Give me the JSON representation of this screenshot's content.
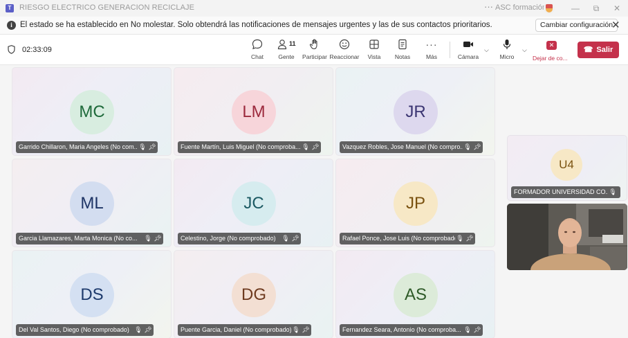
{
  "window": {
    "title": "RIESGO ELECTRICO GENERACION RECICLAJE",
    "more_glyph": "···",
    "org_name": "ASC formación",
    "minimize": "—",
    "restore": "⧉",
    "close": "✕"
  },
  "notification": {
    "text": "El estado se ha establecido en No molestar. Solo obtendrá las notificaciones de mensajes urgentes y las de sus contactos prioritarios.",
    "button": "Cambiar configuración",
    "close": "✕"
  },
  "toolbar": {
    "timer": "02:33:09",
    "chat": "Chat",
    "people": "Gente",
    "people_count": "11",
    "raise": "Participar",
    "react": "Reaccionar",
    "view": "Vista",
    "notes": "Notas",
    "more": "Más",
    "camera": "Cámara",
    "mic": "Micro",
    "leave_short": "Dejar de co...",
    "leave": "Salir"
  },
  "participants": [
    {
      "initials": "MC",
      "name": "Garrido Chillaron, Maria Angeles (No com...",
      "avatar_bg": "#d8ede0",
      "avatar_fg": "#1e6a3a"
    },
    {
      "initials": "LM",
      "name": "Fuente Martín, Luis Miguel (No comproba...",
      "avatar_bg": "#f7d5da",
      "avatar_fg": "#9c2a3d"
    },
    {
      "initials": "JR",
      "name": "Vazquez Robles, Jose Manuel (No compro...",
      "avatar_bg": "#ddd8ee",
      "avatar_fg": "#3b3572"
    },
    {
      "initials": "ML",
      "name": "Garcia Llamazares, Marta Monica (No co...",
      "avatar_bg": "#d3ddf0",
      "avatar_fg": "#1f3566"
    },
    {
      "initials": "JC",
      "name": "Celestino, Jorge (No comprobado)",
      "avatar_bg": "#d6ecef",
      "avatar_fg": "#1c5a63"
    },
    {
      "initials": "JP",
      "name": "Rafael Ponce, Jose Luis (No comprobado)",
      "avatar_bg": "#f7e8c6",
      "avatar_fg": "#7a5210"
    },
    {
      "initials": "DS",
      "name": "Del Val Santos, Diego (No comprobado)",
      "avatar_bg": "#d4e0f2",
      "avatar_fg": "#1d3a6c"
    },
    {
      "initials": "DG",
      "name": "Puente Garcia, Daniel (No comprobado)",
      "avatar_bg": "#f3dfd3",
      "avatar_fg": "#6e3a1f"
    },
    {
      "initials": "AS",
      "name": "Fernandez Seara, Antonio (No comproba...",
      "avatar_bg": "#dcebd9",
      "avatar_fg": "#2e5a28"
    }
  ],
  "side": {
    "initials": "U4",
    "name": "FORMADOR UNIVERSIDAD CO...",
    "avatar_bg": "#f7e8c6",
    "avatar_fg": "#7a5210"
  },
  "icons": {
    "mic_off": "mic-off-icon",
    "pin": "pin-icon"
  },
  "colors": {
    "leave_red": "#c4314b",
    "teams_purple": "#5b5fc7"
  }
}
